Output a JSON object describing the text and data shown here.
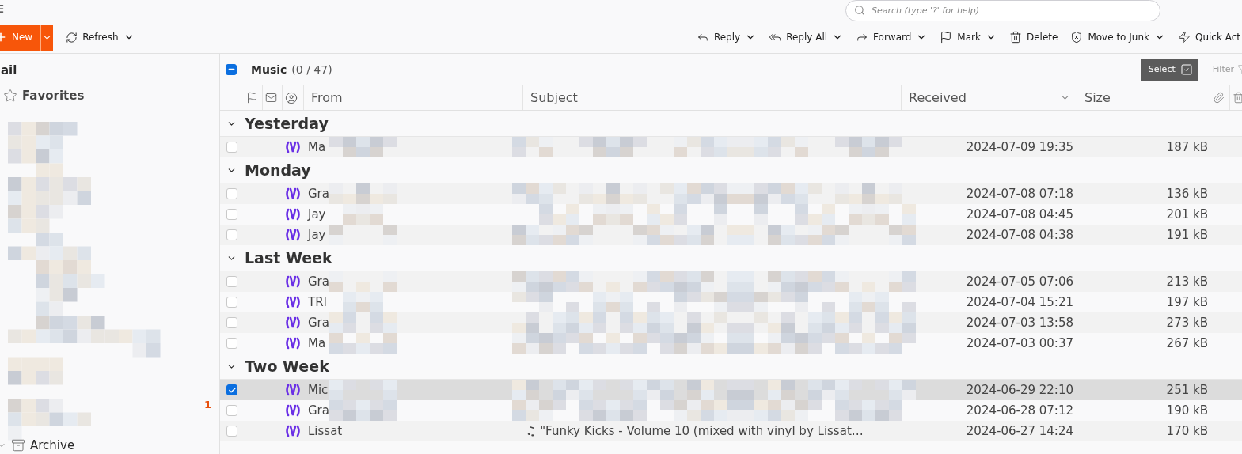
{
  "search": {
    "placeholder": "Search (type '?' for help)"
  },
  "toolbar": {
    "new_label": "New",
    "refresh_label": "Refresh"
  },
  "actions": [
    {
      "kind": "reply",
      "label": "Reply",
      "menu": true
    },
    {
      "kind": "reply-all",
      "label": "Reply All",
      "menu": true
    },
    {
      "kind": "forward",
      "label": "Forward",
      "menu": true
    },
    {
      "kind": "mark",
      "label": "Mark",
      "menu": true
    },
    {
      "kind": "delete",
      "label": "Delete",
      "menu": false
    },
    {
      "kind": "junk",
      "label": "Move to Junk",
      "menu": true
    },
    {
      "kind": "quick",
      "label": "Quick Act",
      "menu": false
    }
  ],
  "sidebar": {
    "title": "ail",
    "favorites": "Favorites",
    "unread_count": "1",
    "archive": "Archive"
  },
  "folder": {
    "name": "Music",
    "count": "(0 / 47)",
    "indeterminate": true,
    "select_label": "Select",
    "filter_label": "Filter"
  },
  "columns": [
    {
      "kind": "flag"
    },
    {
      "kind": "read"
    },
    {
      "kind": "contact"
    },
    {
      "kind": "text",
      "label": "From"
    },
    {
      "kind": "text",
      "label": "Subject"
    },
    {
      "kind": "text",
      "label": "Received",
      "sorted": true
    },
    {
      "kind": "text",
      "label": "Size"
    },
    {
      "kind": "attachment"
    },
    {
      "kind": "delete"
    }
  ],
  "groups": [
    {
      "label": "Yesterday",
      "expanded": true,
      "rows": [
        {
          "from": "Ma",
          "redacted": true,
          "received": "2024-07-09 19:35",
          "size": "187 kB",
          "checked": false,
          "selected": false
        }
      ]
    },
    {
      "label": "Monday",
      "expanded": true,
      "rows": [
        {
          "from": "Gra",
          "redacted": true,
          "received": "2024-07-08 07:18",
          "size": "136 kB",
          "checked": false,
          "selected": false
        },
        {
          "from": "Jay",
          "redacted": true,
          "received": "2024-07-08 04:45",
          "size": "201 kB",
          "checked": false,
          "selected": false
        },
        {
          "from": "Jay",
          "redacted": true,
          "received": "2024-07-08 04:38",
          "size": "191 kB",
          "checked": false,
          "selected": false
        }
      ]
    },
    {
      "label": "Last Week",
      "expanded": true,
      "rows": [
        {
          "from": "Gra",
          "redacted": true,
          "received": "2024-07-05 07:06",
          "size": "213 kB",
          "checked": false,
          "selected": false
        },
        {
          "from": "TRI",
          "redacted": true,
          "received": "2024-07-04 15:21",
          "size": "197 kB",
          "checked": false,
          "selected": false
        },
        {
          "from": "Gra",
          "redacted": true,
          "received": "2024-07-03 13:58",
          "size": "273 kB",
          "checked": false,
          "selected": false
        },
        {
          "from": "Ma",
          "redacted": true,
          "received": "2024-07-03 00:37",
          "size": "267 kB",
          "checked": false,
          "selected": false
        }
      ]
    },
    {
      "label": "Two Week",
      "expanded": true,
      "rows": [
        {
          "from": "Mic",
          "redacted": true,
          "received": "2024-06-29 22:10",
          "size": "251 kB",
          "checked": true,
          "selected": true
        },
        {
          "from": "Gra",
          "redacted": true,
          "received": "2024-06-28 07:12",
          "size": "190 kB",
          "checked": false,
          "selected": false
        },
        {
          "from": "Lissat",
          "subject": "♫ \"Funky Kicks - Volume 10 (mixed with vinyl by Lissat…",
          "redacted": false,
          "received": "2024-06-27 14:24",
          "size": "170 kB",
          "checked": false,
          "selected": false
        }
      ]
    }
  ]
}
